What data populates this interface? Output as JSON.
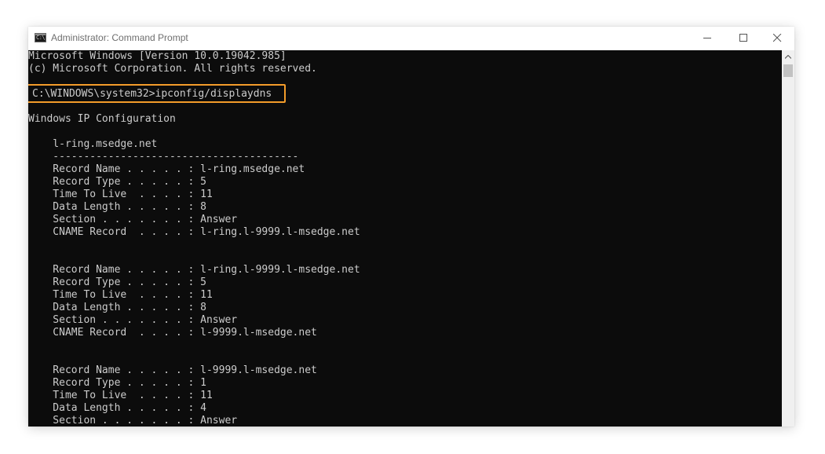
{
  "window": {
    "title": "Administrator: Command Prompt",
    "icon_label": "C:\\"
  },
  "controls": {
    "minimize_icon": "minimize-icon",
    "maximize_icon": "maximize-icon",
    "close_icon": "close-icon"
  },
  "console": {
    "lines": [
      "Microsoft Windows [Version 10.0.19042.985]",
      "(c) Microsoft Corporation. All rights reserved.",
      "",
      "C:\\WINDOWS\\system32>ipconfig/displaydns",
      "",
      "Windows IP Configuration",
      "",
      "    l-ring.msedge.net",
      "    ----------------------------------------",
      "    Record Name . . . . . : l-ring.msedge.net",
      "    Record Type . . . . . : 5",
      "    Time To Live  . . . . : 11",
      "    Data Length . . . . . : 8",
      "    Section . . . . . . . : Answer",
      "    CNAME Record  . . . . : l-ring.l-9999.l-msedge.net",
      "",
      "",
      "    Record Name . . . . . : l-ring.l-9999.l-msedge.net",
      "    Record Type . . . . . : 5",
      "    Time To Live  . . . . : 11",
      "    Data Length . . . . . : 8",
      "    Section . . . . . . . : Answer",
      "    CNAME Record  . . . . : l-9999.l-msedge.net",
      "",
      "",
      "    Record Name . . . . . : l-9999.l-msedge.net",
      "    Record Type . . . . . : 1",
      "    Time To Live  . . . . : 11",
      "    Data Length . . . . . : 4",
      "    Section . . . . . . . : Answer"
    ]
  },
  "colors": {
    "console_bg": "#0c0c0c",
    "console_text": "#cccccc",
    "highlight": "#f39c2a"
  }
}
